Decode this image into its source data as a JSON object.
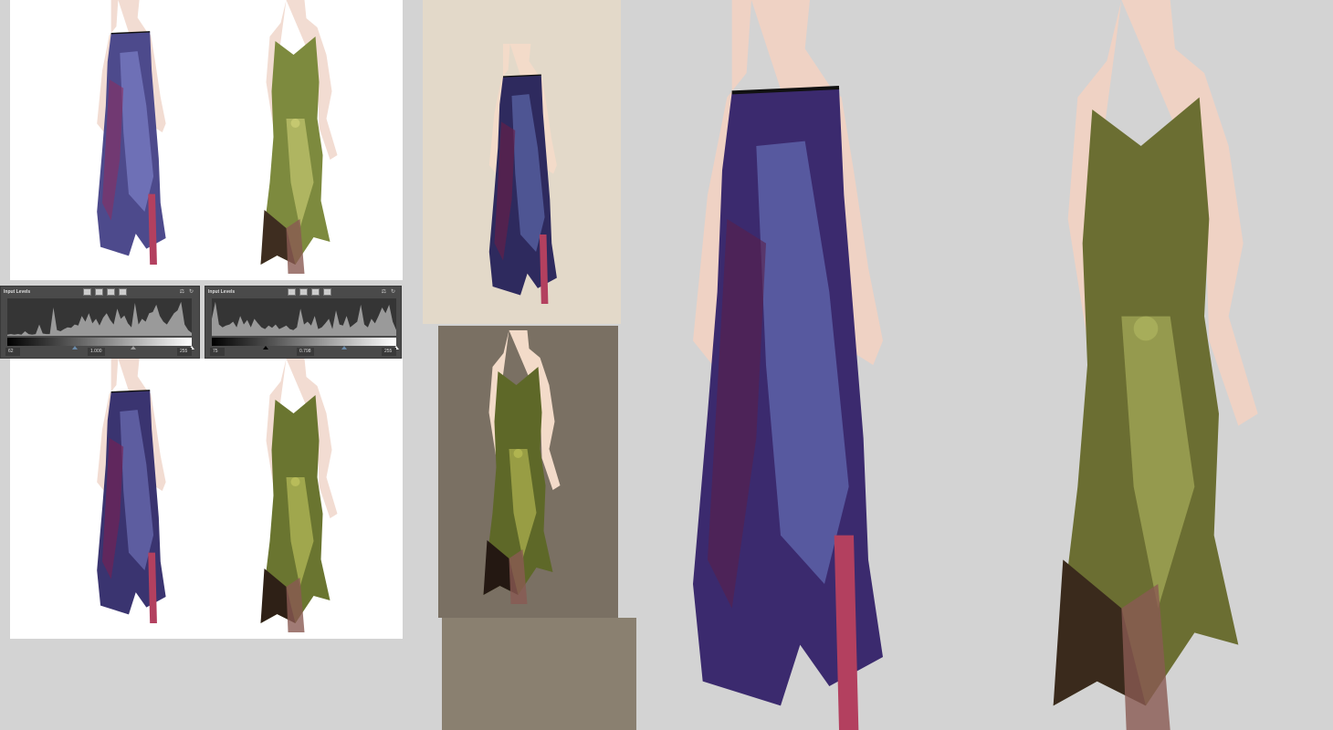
{
  "colors": {
    "background": "#d3d3d3",
    "purple_dress": "#3b2a6e",
    "purple_light": "#6f7fc8",
    "purple_shadow": "#5a1f4a",
    "olive_dress": "#6b6e32",
    "olive_light": "#a7ad5a",
    "olive_shadow": "#3a2a1c",
    "skin": "#efd2c4",
    "beige_panel": "#e3d9c9",
    "taupe_panel": "#7a7063"
  },
  "levels_panels": [
    {
      "title": "Input Levels",
      "black_input": "62",
      "gamma": "1.000",
      "white_input": "255",
      "histogram": [
        2,
        3,
        2,
        3,
        2,
        8,
        3,
        2,
        3,
        20,
        4,
        3,
        3,
        50,
        10,
        8,
        12,
        15,
        14,
        20,
        18,
        35,
        25,
        40,
        22,
        30,
        18,
        32,
        40,
        28,
        20,
        48,
        30,
        36,
        22,
        15,
        58,
        20,
        30,
        25,
        40,
        42,
        55,
        35,
        25,
        20,
        30,
        40,
        45,
        60,
        20,
        10,
        5
      ]
    },
    {
      "title": "Input Levels",
      "black_input": "75",
      "gamma": "0.798",
      "white_input": "255",
      "histogram": [
        30,
        60,
        20,
        15,
        18,
        20,
        25,
        15,
        35,
        20,
        28,
        15,
        30,
        22,
        15,
        12,
        18,
        14,
        20,
        12,
        15,
        18,
        12,
        10,
        15,
        48,
        20,
        25,
        18,
        35,
        12,
        15,
        22,
        30,
        12,
        45,
        20,
        18,
        35,
        15,
        20,
        25,
        55,
        20,
        15,
        30,
        22,
        35,
        50,
        40,
        55,
        25,
        10
      ]
    }
  ]
}
